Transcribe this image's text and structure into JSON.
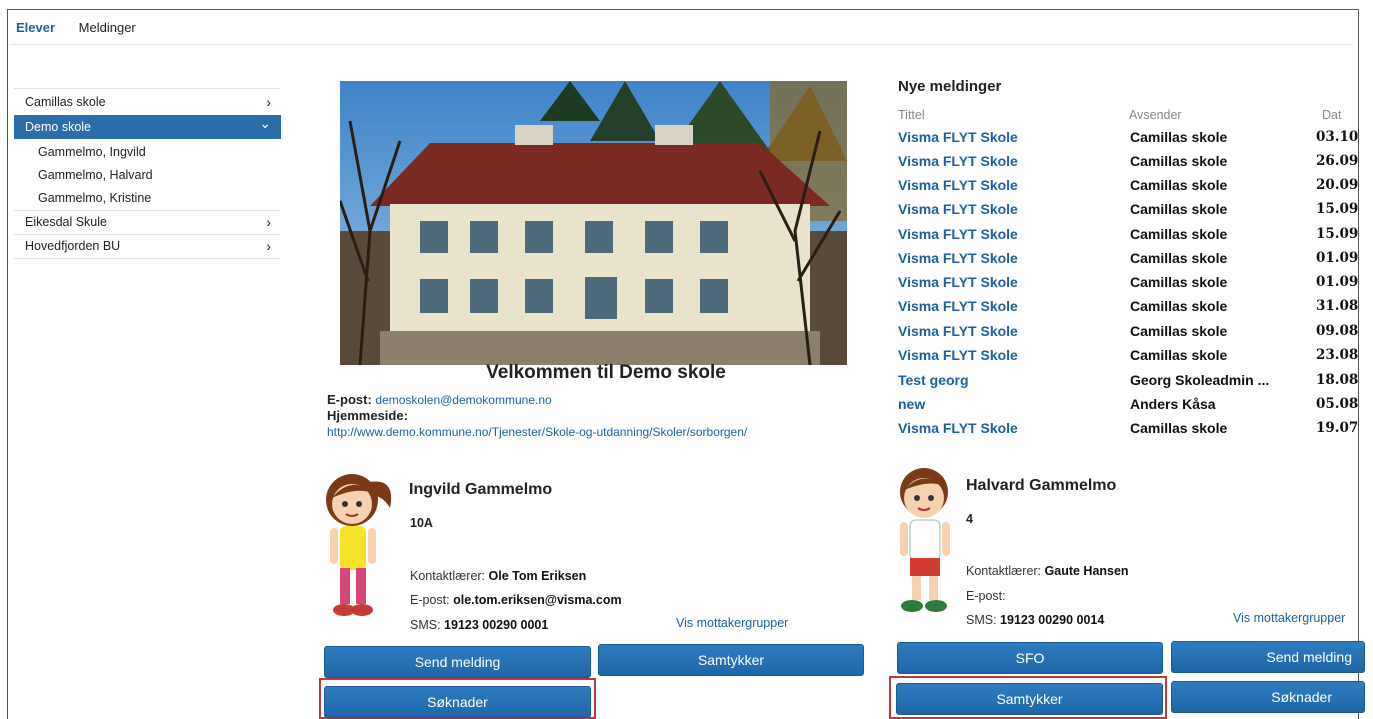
{
  "nav": {
    "tab_elever": "Elever",
    "tab_meldinger": "Meldinger"
  },
  "sidebar": {
    "schools": [
      {
        "label": "Camillas skole",
        "icon": "chevron-right-icon"
      },
      {
        "label": "Demo skole",
        "icon": "chevron-down-icon",
        "selected": true,
        "children": [
          "Gammelmo, Ingvild",
          "Gammelmo, Halvard",
          "Gammelmo, Kristine"
        ]
      },
      {
        "label": "Eikesdal Skule",
        "icon": "chevron-right-icon"
      },
      {
        "label": "Hovedfjorden BU",
        "icon": "chevron-right-icon"
      }
    ],
    "chevron_right": "›",
    "chevron_down": "⌄"
  },
  "school": {
    "welcome": "Velkommen til Demo skole",
    "email_label": "E-post:",
    "email": "demoskolen@demokommune.no",
    "homepage_label": "Hjemmeside:",
    "homepage": "http://www.demo.kommune.no/Tjenester/Skole-og-utdanning/Skoler/sorborgen/"
  },
  "messages": {
    "title": "Nye meldinger",
    "columns": [
      "Tittel",
      "Avsender",
      "Dat"
    ],
    "rows": [
      {
        "title": "Visma FLYT Skole",
        "sender": "Camillas skole",
        "date": "03.10"
      },
      {
        "title": "Visma FLYT Skole",
        "sender": "Camillas skole",
        "date": "26.09"
      },
      {
        "title": "Visma FLYT Skole",
        "sender": "Camillas skole",
        "date": "20.09"
      },
      {
        "title": "Visma FLYT Skole",
        "sender": "Camillas skole",
        "date": "15.09"
      },
      {
        "title": "Visma FLYT Skole",
        "sender": "Camillas skole",
        "date": "15.09"
      },
      {
        "title": "Visma FLYT Skole",
        "sender": "Camillas skole",
        "date": "01.09"
      },
      {
        "title": "Visma FLYT Skole",
        "sender": "Camillas skole",
        "date": "01.09"
      },
      {
        "title": "Visma FLYT Skole",
        "sender": "Camillas skole",
        "date": "31.08"
      },
      {
        "title": "Visma FLYT Skole",
        "sender": "Camillas skole",
        "date": "09.08"
      },
      {
        "title": "Visma FLYT Skole",
        "sender": "Camillas skole",
        "date": "23.08"
      },
      {
        "title": "Test georg",
        "sender": "Georg Skoleadmin ...",
        "date": "18.08"
      },
      {
        "title": "new",
        "sender": "Anders Kåsa",
        "date": "05.08"
      },
      {
        "title": "Visma FLYT Skole",
        "sender": "Camillas skole",
        "date": "19.07"
      }
    ]
  },
  "students": [
    {
      "name": "Ingvild Gammelmo",
      "class": "10A",
      "teacher_label": "Kontaktlærer:",
      "teacher": "Ole Tom Eriksen",
      "email_label": "E-post:",
      "email": "ole.tom.eriksen@visma.com",
      "sms_label": "SMS:",
      "sms": "19123 00290 0001",
      "link": "Vis mottakergrupper",
      "buttons": [
        "Send melding",
        "Samtykker",
        "Søknader"
      ]
    },
    {
      "name": "Halvard Gammelmo",
      "class": "4",
      "teacher_label": "Kontaktlærer:",
      "teacher": "Gaute Hansen",
      "email_label": "E-post:",
      "email": "",
      "sms_label": "SMS:",
      "sms": "19123 00290 0014",
      "link": "Vis mottakergrupper",
      "buttons": [
        "SFO",
        "Send melding",
        "Samtykker",
        "Søknader"
      ]
    }
  ],
  "colors": {
    "accent": "#1f5fa0",
    "button": "#2a74b8",
    "selected": "#2a6da8",
    "highlight": "#c0393b"
  }
}
